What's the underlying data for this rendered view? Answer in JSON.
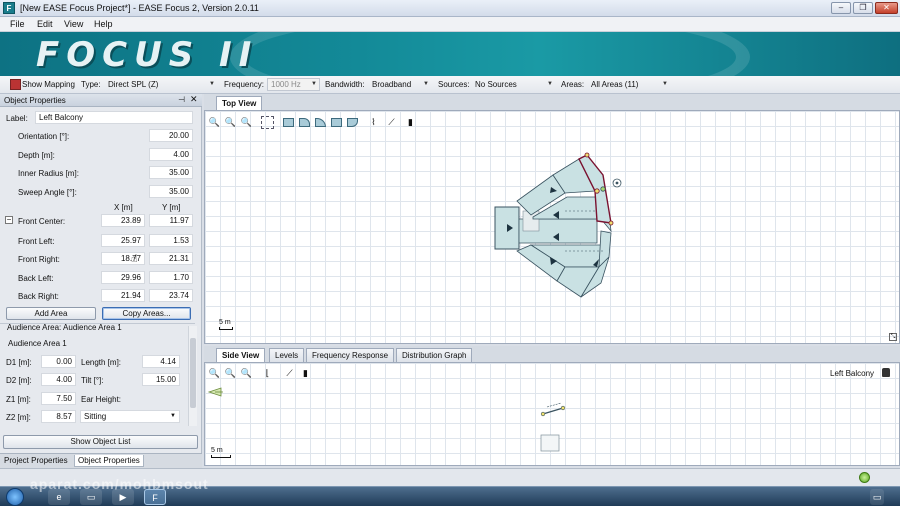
{
  "window": {
    "title": "[New EASE Focus Project*] - EASE Focus 2, Version 2.0.11",
    "min_label": "–",
    "max_label": "❐",
    "close_label": "✕"
  },
  "menu": {
    "items": [
      "File",
      "Edit",
      "View",
      "Help"
    ]
  },
  "banner": {
    "logo": "FOCUS II"
  },
  "optbar": {
    "show_mapping": "Show Mapping",
    "type_label": "Type:",
    "type_value": "Direct SPL (Z)",
    "frequency_label": "Frequency:",
    "frequency_value": "1000 Hz",
    "bandwidth_label": "Bandwidth:",
    "bandwidth_value": "Broadband",
    "sources_label": "Sources:",
    "sources_value": "No Sources",
    "areas_label": "Areas:",
    "areas_value": "All Areas (11)"
  },
  "object_properties": {
    "header": "Object Properties",
    "label_label": "Label:",
    "label_value": "Left Balcony",
    "orientation_label": "Orientation [°]:",
    "orientation_value": "20.00",
    "depth_label": "Depth [m]:",
    "depth_value": "4.00",
    "inner_radius_label": "Inner Radius [m]:",
    "inner_radius_value": "35.00",
    "sweep_angle_label": "Sweep Angle [°]:",
    "sweep_angle_value": "35.00",
    "x_header": "X [m]",
    "y_header": "Y [m]",
    "expander": "−",
    "points": [
      {
        "label": "Front Center:",
        "x": "23.89",
        "y": "11.97"
      },
      {
        "label": "Front Left:",
        "x": "25.97",
        "y": "1.53"
      },
      {
        "label": "Front Right:",
        "x": "18.77",
        "y": "21.31"
      },
      {
        "label": "Back Left:",
        "x": "29.96",
        "y": "1.70"
      },
      {
        "label": "Back Right:",
        "x": "21.94",
        "y": "23.74"
      }
    ],
    "add_area": "Add Area",
    "copy_areas": "Copy Areas...",
    "audience_area_header": "Audience Area: Audience Area 1",
    "audience_area_name": "Audience Area 1",
    "d1_label": "D1 [m]:",
    "d1_value": "0.00",
    "length_label": "Length [m]:",
    "length_value": "4.14",
    "d2_label": "D2 [m]:",
    "d2_value": "4.00",
    "tilt_label": "Tilt [°]:",
    "tilt_value": "15.00",
    "z1_label": "Z1 [m]:",
    "z1_value": "7.50",
    "ear_height_label": "Ear Height:",
    "z2_label": "Z2 [m]:",
    "z2_value": "8.57",
    "ear_height_value": "Sitting",
    "show_object_list": "Show Object List",
    "bottom_tabs": [
      "Project Properties",
      "Object Properties"
    ]
  },
  "top_view": {
    "tab": "Top View",
    "scale": "5 m"
  },
  "bottom_view": {
    "tabs": [
      "Side View",
      "Levels",
      "Frequency Response",
      "Distribution Graph"
    ],
    "object_label": "Left Balcony",
    "scale": "5 m"
  },
  "watermark": "aparat.com/mohbmsout",
  "colors": {
    "banner": "#138a98",
    "selected_area": "#7a1230",
    "area_fill": "#c9e1e3"
  }
}
